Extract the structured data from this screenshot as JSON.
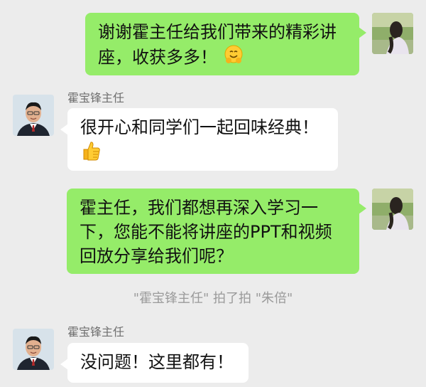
{
  "messages": [
    {
      "side": "right",
      "lines": [
        "谢谢霍主任给我们带来的精彩讲",
        "座，收获多多！"
      ],
      "emoji": "hugging-face-icon"
    },
    {
      "side": "left",
      "sender": "霍宝锋主任",
      "lines": [
        "很开心和同学们一起回味经典！"
      ],
      "emoji": "thumbs-up-icon"
    },
    {
      "side": "right",
      "lines": [
        "霍主任，我们都想再深入学习一",
        "下，您能不能将讲座的PPT和视频",
        "回放分享给我们呢？"
      ]
    },
    {
      "side": "system",
      "text": "\"霍宝锋主任\" 拍了拍 \"朱倍\""
    },
    {
      "side": "left",
      "sender": "霍宝锋主任",
      "lines": [
        "没问题！这里都有！"
      ]
    }
  ],
  "colors": {
    "background": "#ececec",
    "outgoing_bubble": "#95ec69",
    "incoming_bubble": "#ffffff"
  }
}
